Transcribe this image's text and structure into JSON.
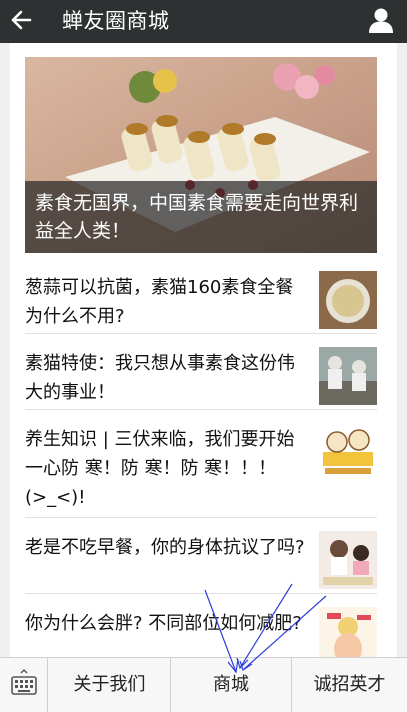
{
  "header": {
    "title": "蝉友圈商城",
    "back_icon": "arrow-left-icon",
    "user_icon": "user-icon",
    "background": "#2e3132"
  },
  "banner": {
    "caption": "素食无国界，中国素食需要走向世界利益全人类！"
  },
  "news": [
    {
      "title": "葱蒜可以抗菌，素猫160素食全餐为什么不用?"
    },
    {
      "title": "素猫特使：我只想从事素食这份伟大的事业！"
    },
    {
      "title": "养生知识 | 三伏来临，我们要开始一心防 寒！防 寒！防 寒！！！(>_<)!"
    },
    {
      "title": "老是不吃早餐，你的身体抗议了吗?"
    },
    {
      "title": "你为什么会胖? 不同部位如何减肥?"
    }
  ],
  "bottom_bar": {
    "keyboard_icon": "keyboard-icon",
    "tabs": [
      "关于我们",
      "商城",
      "诚招英才"
    ]
  }
}
